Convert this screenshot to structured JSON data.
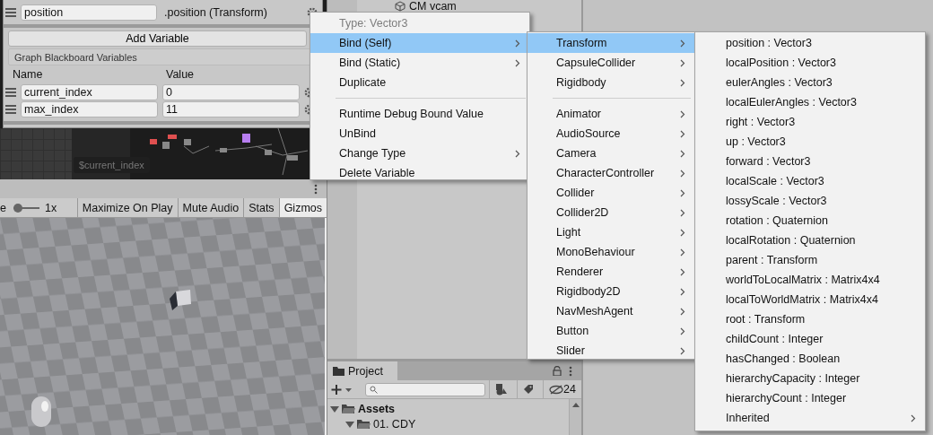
{
  "blackboard": {
    "bound_rows": [
      {
        "name": "position",
        "binding": ".position (Transform)"
      }
    ],
    "add_button": "Add Variable",
    "section_title": "Graph Blackboard Variables",
    "columns": [
      "Name",
      "Value"
    ],
    "variables": [
      {
        "name": "current_index",
        "value": "0"
      },
      {
        "name": "max_index",
        "value": "11"
      }
    ]
  },
  "graph": {
    "node_label": "$current_index"
  },
  "hierarchy": {
    "items": [
      {
        "label": "CM vcam"
      }
    ]
  },
  "game_toolbar": {
    "scale_fragment": "e",
    "scale_slider": {
      "level": 0
    },
    "scale_value": "1x",
    "toggles": [
      {
        "label": "Maximize On Play",
        "selected": false
      },
      {
        "label": "Mute Audio",
        "selected": false
      },
      {
        "label": "Stats",
        "selected": false
      },
      {
        "label": "Gizmos",
        "selected": true
      }
    ]
  },
  "project": {
    "tab": "Project",
    "hidden_count": "24",
    "tree": [
      {
        "label": "Assets",
        "expanded": true,
        "children": [
          {
            "label": "01. CDY",
            "expanded": true
          }
        ]
      }
    ]
  },
  "context_menu": {
    "header": "Type: Vector3",
    "groups": [
      {
        "items": [
          {
            "label": "Bind (Self)",
            "submenu": true,
            "selected": true
          },
          {
            "label": "Bind (Static)",
            "submenu": true,
            "selected": false
          },
          {
            "label": "Duplicate",
            "submenu": false,
            "selected": false
          }
        ]
      },
      {
        "items": [
          {
            "label": "Runtime Debug Bound Value",
            "submenu": false,
            "selected": false
          },
          {
            "label": "UnBind",
            "submenu": false,
            "selected": false
          },
          {
            "label": "Change Type",
            "submenu": true,
            "selected": false
          },
          {
            "label": "Delete Variable",
            "submenu": false,
            "selected": false
          }
        ]
      }
    ]
  },
  "component_menu": {
    "groups": [
      {
        "items": [
          {
            "label": "Transform",
            "submenu": true,
            "selected": true
          },
          {
            "label": "CapsuleCollider",
            "submenu": true,
            "selected": false
          },
          {
            "label": "Rigidbody",
            "submenu": true,
            "selected": false
          }
        ]
      },
      {
        "items": [
          {
            "label": "Animator",
            "submenu": true,
            "selected": false
          },
          {
            "label": "AudioSource",
            "submenu": true,
            "selected": false
          },
          {
            "label": "Camera",
            "submenu": true,
            "selected": false
          },
          {
            "label": "CharacterController",
            "submenu": true,
            "selected": false
          },
          {
            "label": "Collider",
            "submenu": true,
            "selected": false
          },
          {
            "label": "Collider2D",
            "submenu": true,
            "selected": false
          },
          {
            "label": "Light",
            "submenu": true,
            "selected": false
          },
          {
            "label": "MonoBehaviour",
            "submenu": true,
            "selected": false
          },
          {
            "label": "Renderer",
            "submenu": true,
            "selected": false
          },
          {
            "label": "Rigidbody2D",
            "submenu": true,
            "selected": false
          },
          {
            "label": "NavMeshAgent",
            "submenu": true,
            "selected": false
          },
          {
            "label": "Button",
            "submenu": true,
            "selected": false
          },
          {
            "label": "Slider",
            "submenu": true,
            "selected": false
          }
        ]
      }
    ]
  },
  "member_menu": {
    "groups": [
      {
        "items": [
          {
            "label": "position : Vector3",
            "submenu": false,
            "selected": false
          },
          {
            "label": "localPosition : Vector3",
            "submenu": false,
            "selected": false
          },
          {
            "label": "eulerAngles : Vector3",
            "submenu": false,
            "selected": false
          },
          {
            "label": "localEulerAngles : Vector3",
            "submenu": false,
            "selected": false
          },
          {
            "label": "right : Vector3",
            "submenu": false,
            "selected": false
          },
          {
            "label": "up : Vector3",
            "submenu": false,
            "selected": false
          },
          {
            "label": "forward : Vector3",
            "submenu": false,
            "selected": false
          },
          {
            "label": "localScale : Vector3",
            "submenu": false,
            "selected": false
          },
          {
            "label": "lossyScale : Vector3",
            "submenu": false,
            "selected": false
          },
          {
            "label": "rotation : Quaternion",
            "submenu": false,
            "selected": false
          },
          {
            "label": "localRotation : Quaternion",
            "submenu": false,
            "selected": false
          },
          {
            "label": "parent : Transform",
            "submenu": false,
            "selected": false
          },
          {
            "label": "worldToLocalMatrix : Matrix4x4",
            "submenu": false,
            "selected": false
          },
          {
            "label": "localToWorldMatrix : Matrix4x4",
            "submenu": false,
            "selected": false
          },
          {
            "label": "root : Transform",
            "submenu": false,
            "selected": false
          },
          {
            "label": "childCount : Integer",
            "submenu": false,
            "selected": false
          },
          {
            "label": "hasChanged : Boolean",
            "submenu": false,
            "selected": false
          },
          {
            "label": "hierarchyCapacity : Integer",
            "submenu": false,
            "selected": false
          },
          {
            "label": "hierarchyCount : Integer",
            "submenu": false,
            "selected": false
          },
          {
            "label": "Inherited",
            "submenu": true,
            "selected": false
          }
        ]
      }
    ]
  }
}
